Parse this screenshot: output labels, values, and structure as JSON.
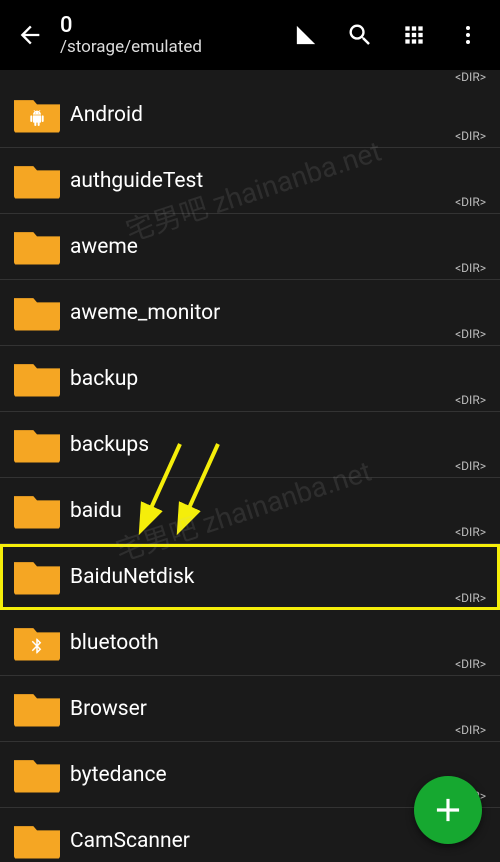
{
  "header": {
    "count": "0",
    "path": "/storage/emulated"
  },
  "partial_top_tag": "<DIR>",
  "folders": [
    {
      "name": "Android",
      "tag": "<DIR>",
      "badge": "android",
      "highlight": false
    },
    {
      "name": "authguideTest",
      "tag": "<DIR>",
      "badge": null,
      "highlight": false
    },
    {
      "name": "aweme",
      "tag": "<DIR>",
      "badge": null,
      "highlight": false
    },
    {
      "name": "aweme_monitor",
      "tag": "<DIR>",
      "badge": null,
      "highlight": false
    },
    {
      "name": "backup",
      "tag": "<DIR>",
      "badge": null,
      "highlight": false
    },
    {
      "name": "backups",
      "tag": "<DIR>",
      "badge": null,
      "highlight": false
    },
    {
      "name": "baidu",
      "tag": "<DIR>",
      "badge": null,
      "highlight": false
    },
    {
      "name": "BaiduNetdisk",
      "tag": "<DIR>",
      "badge": null,
      "highlight": true
    },
    {
      "name": "bluetooth",
      "tag": "<DIR>",
      "badge": "bluetooth",
      "highlight": false
    },
    {
      "name": "Browser",
      "tag": "<DIR>",
      "badge": null,
      "highlight": false
    },
    {
      "name": "bytedance",
      "tag": "<DIR>",
      "badge": null,
      "highlight": false
    },
    {
      "name": "CamScanner",
      "tag": "",
      "badge": null,
      "highlight": false
    }
  ],
  "watermark": "宅男吧 zhainanba.net"
}
